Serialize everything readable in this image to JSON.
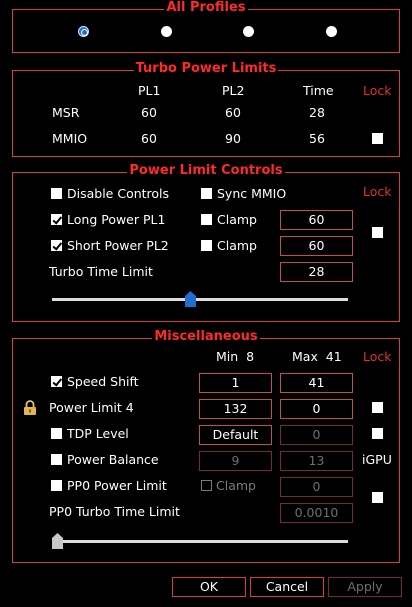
{
  "profiles": {
    "title": "All Profiles",
    "selected_index": 0,
    "count": 4
  },
  "turbo": {
    "title": "Turbo Power Limits",
    "headers": {
      "pl1": "PL1",
      "pl2": "PL2",
      "time": "Time",
      "lock": "Lock"
    },
    "rows": [
      {
        "name": "MSR",
        "pl1": "60",
        "pl2": "60",
        "time": "28"
      },
      {
        "name": "MMIO",
        "pl1": "60",
        "pl2": "90",
        "time": "56"
      }
    ]
  },
  "plc": {
    "title": "Power Limit Controls",
    "disable_controls": "Disable Controls",
    "sync_mmio": "Sync MMIO",
    "lock": "Lock",
    "long_pl1": "Long Power PL1",
    "short_pl2": "Short Power PL2",
    "clamp": "Clamp",
    "pl1_value": "60",
    "pl2_value": "60",
    "turbo_time_label": "Turbo Time Limit",
    "turbo_time_value": "28",
    "slider_level": 0.465
  },
  "misc": {
    "title": "Miscellaneous",
    "min_label": "Min  8",
    "max_label": "Max  41",
    "lock": "Lock",
    "speed_shift": "Speed Shift",
    "speed_min": "1",
    "speed_max": "41",
    "power_limit4": "Power Limit 4",
    "pl4_value": "132",
    "pl4_value2": "0",
    "tdp_level": "TDP Level",
    "tdp_value": "Default",
    "tdp_value2": "0",
    "power_balance": "Power Balance",
    "pb_value": "9",
    "pb_value2": "13",
    "igpu": "iGPU",
    "pp0_power_limit": "PP0 Power Limit",
    "pp0_clamp": "Clamp",
    "pp0_value": "0",
    "pp0_turbo_label": "PP0 Turbo Time Limit",
    "pp0_turbo_value": "0.0010",
    "slider_level": 0.0
  },
  "buttons": {
    "ok": "OK",
    "cancel": "Cancel",
    "apply": "Apply"
  },
  "colors": {
    "accent_red": "#ff2a2a",
    "border_red": "#d34040",
    "radio_blue": "#1f6fd0"
  }
}
